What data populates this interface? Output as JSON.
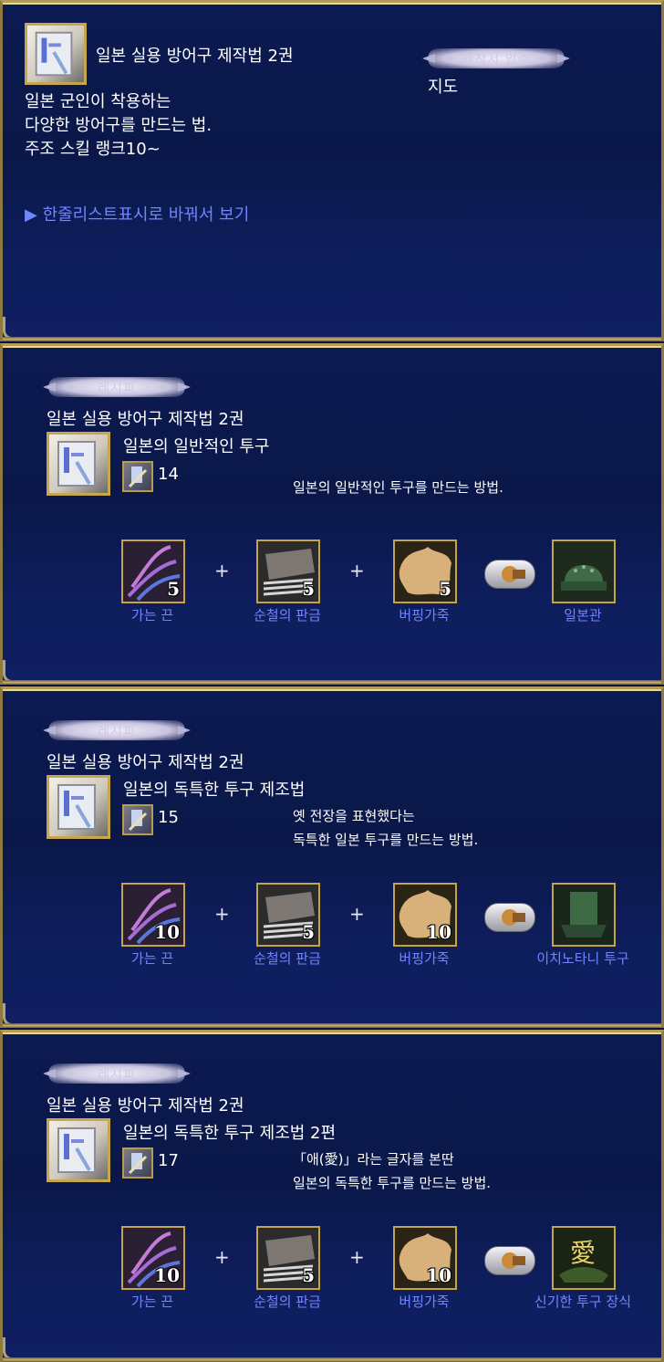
{
  "header": {
    "book_name": "일본 실용 방어구 제작법 2권",
    "desc_lines": [
      "일본 군인이 착용하는",
      "다양한 방어구를 만드는 법.",
      "주조 스킬 랭크10~"
    ],
    "banner_text": "제작서 입수",
    "location": "지도",
    "view_link": "▶ 한줄리스트표시로 바꿔서 보기"
  },
  "recipe_banner_text": "레시피",
  "recipes": [
    {
      "book_name": "일본 실용 방어구 제작법 2권",
      "recipe_name": "일본의 일반적인 투구",
      "rank": "14",
      "desc_lines": [
        "일본의 일반적인 투구를 만드는 방법."
      ],
      "ingredients": [
        {
          "name": "가는 끈",
          "qty": "5"
        },
        {
          "name": "순철의 판금",
          "qty": "5"
        },
        {
          "name": "버핑가죽",
          "qty": "5"
        }
      ],
      "plus": "+",
      "result": {
        "name": "일본관"
      }
    },
    {
      "book_name": "일본 실용 방어구 제작법 2권",
      "recipe_name": "일본의 독특한 투구 제조법",
      "rank": "15",
      "desc_lines": [
        "옛 전장을 표현했다는",
        "독특한 일본 투구를 만드는 방법."
      ],
      "ingredients": [
        {
          "name": "가는 끈",
          "qty": "10"
        },
        {
          "name": "순철의 판금",
          "qty": "5"
        },
        {
          "name": "버핑가죽",
          "qty": "10"
        }
      ],
      "plus": "+",
      "result": {
        "name": "이치노타니 투구"
      }
    },
    {
      "book_name": "일본 실용 방어구 제작법 2권",
      "recipe_name": "일본의 독특한 투구 제조법 2편",
      "rank": "17",
      "desc_lines": [
        "「애(愛)」라는 글자를 본딴",
        "일본의 독특한 투구를 만드는 방법."
      ],
      "ingredients": [
        {
          "name": "가는 끈",
          "qty": "10"
        },
        {
          "name": "순철의 판금",
          "qty": "5"
        },
        {
          "name": "버핑가죽",
          "qty": "10"
        }
      ],
      "plus": "+",
      "result": {
        "name": "신기한 투구 장식",
        "glyph": "愛"
      }
    }
  ]
}
